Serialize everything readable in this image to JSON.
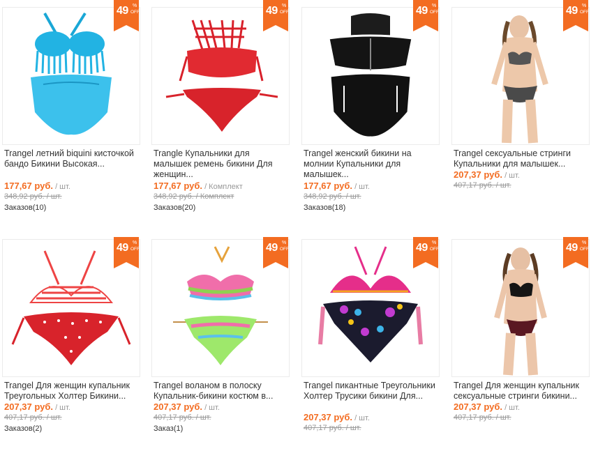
{
  "accent_color": "#f36c21",
  "products": [
    {
      "title": "Trangel летний biquini кисточкой бандо Бикини Высокая...",
      "price": "177,67 руб.",
      "unit": " / шт.",
      "old_price": "348,92 руб. / шт.",
      "orders": "Заказов(10)",
      "discount": "49",
      "pct": "%",
      "off": "OFF",
      "image_icon": "blue-fringe-bikini-image"
    },
    {
      "title": "Trangle Купальники для малышек ремень бикини Для женщин...",
      "price": "177,67 руб.",
      "unit": " / Комплект",
      "old_price": "348,92 руб. / Комплект",
      "orders": "Заказов(20)",
      "discount": "49",
      "pct": "%",
      "off": "OFF",
      "image_icon": "red-strappy-bikini-image"
    },
    {
      "title": "Trangel женский бикини на молнии Купальники для малышек...",
      "price": "177,67 руб.",
      "unit": " / шт.",
      "old_price": "348,92 руб. / шт.",
      "orders": "Заказов(18)",
      "discount": "49",
      "pct": "%",
      "off": "OFF",
      "image_icon": "black-zip-bikini-image"
    },
    {
      "title": "Trangel сексуальные стринги Купальники для малышек...",
      "price": "207,37 руб.",
      "unit": " / шт.",
      "old_price": "407,17 руб. / шт.",
      "orders": "",
      "discount": "49",
      "pct": "%",
      "off": "OFF",
      "image_icon": "model-paisley-bikini-image"
    },
    {
      "title": "Trangel Для женщин купальник Треугольных Холтер Бикини...",
      "price": "207,37 руб.",
      "unit": " / шт.",
      "old_price": "407,17 руб. / шт.",
      "orders": "Заказов(2)",
      "discount": "49",
      "pct": "%",
      "off": "OFF",
      "image_icon": "red-polka-bikini-image"
    },
    {
      "title": "Trangel воланом в полоску Купальник-бикини костюм в...",
      "price": "207,37 руб.",
      "unit": " / шт.",
      "old_price": "407,17 руб. / шт.",
      "orders": "Заказ(1)",
      "discount": "49",
      "pct": "%",
      "off": "OFF",
      "image_icon": "ruffle-stripe-bikini-image"
    },
    {
      "title": "Trangel пикантные Треугольники Холтер Трусики бикини Для...",
      "price": "207,37 руб.",
      "unit": " / шт.",
      "old_price": "407,17 руб. / шт.",
      "orders": "",
      "discount": "49",
      "pct": "%",
      "off": "OFF",
      "image_icon": "pink-floral-bikini-image"
    },
    {
      "title": "Trangel Для женщин купальник сексуальные стринги бикини...",
      "price": "207,37 руб.",
      "unit": " / шт.",
      "old_price": "407,17 руб. / шт.",
      "orders": "",
      "discount": "49",
      "pct": "%",
      "off": "OFF",
      "image_icon": "model-black-bikini-image"
    }
  ]
}
